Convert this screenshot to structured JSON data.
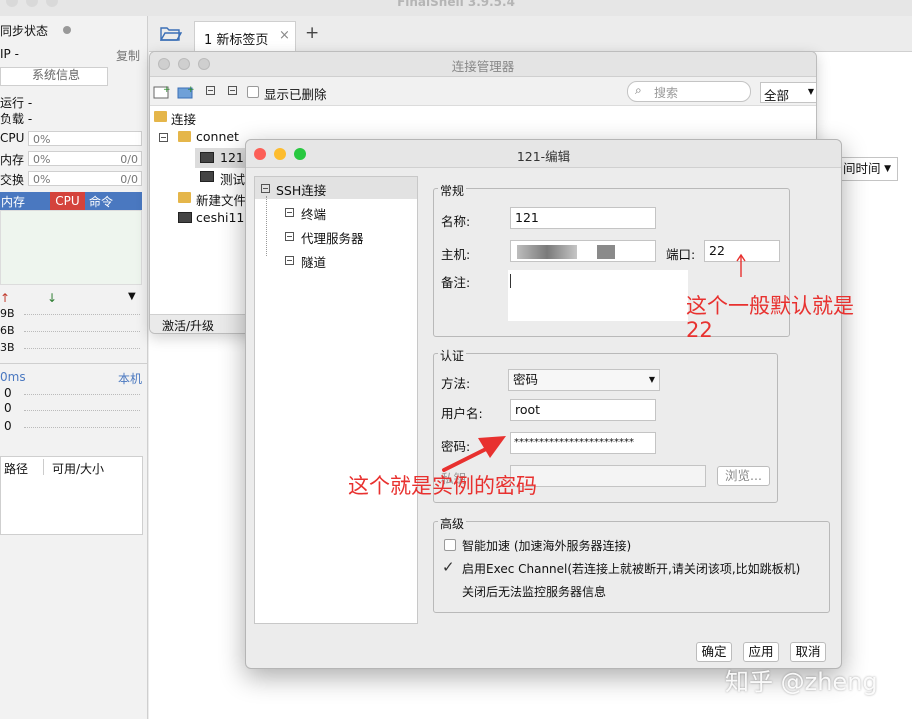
{
  "app": {
    "title": "FinalShell 3.9.5.4"
  },
  "left_panel": {
    "sync_status": "同步状态",
    "ip_label": "IP -",
    "copy_label": "复制",
    "sysinfo_button": "系统信息",
    "running": "运行 -",
    "load": "负载 -",
    "cpu_label": "CPU",
    "cpu_value": "0%",
    "mem_label": "内存",
    "mem_value": "0%",
    "mem_ratio": "0/0",
    "swap_label": "交换",
    "swap_value": "0%",
    "swap_ratio": "0/0",
    "table_headers": [
      "内存",
      "CPU",
      "命令"
    ],
    "net_rows": [
      "9B",
      "6B",
      "3B"
    ],
    "latency": "0ms",
    "local": "本机",
    "zeros": [
      "0",
      "0",
      "0"
    ],
    "disk_headers": [
      "路径",
      "可用/大小"
    ]
  },
  "tabs": [
    {
      "label": "1 新标签页"
    }
  ],
  "conn_manager": {
    "title": "连接管理器",
    "show_deleted": "显示已删除",
    "search_placeholder": "搜索",
    "filter_value": "全部",
    "tree": {
      "root": "连接",
      "folder": "connet",
      "items": [
        "121",
        "测试"
      ],
      "new_folder": "新建文件",
      "ceshi": "ceshi11"
    },
    "activate_button": "激活/升级",
    "sort_dropdown": "间时间"
  },
  "editor": {
    "title": "121-编辑",
    "side_tree": {
      "root": "SSH连接",
      "children": [
        "终端",
        "代理服务器",
        "隧道"
      ]
    },
    "general": {
      "title": "常规",
      "name_label": "名称:",
      "name_value": "121",
      "host_label": "主机:",
      "port_label": "端口:",
      "port_value": "22",
      "note_label": "备注:"
    },
    "auth": {
      "title": "认证",
      "method_label": "方法:",
      "method_value": "密码",
      "user_label": "用户名:",
      "user_value": "root",
      "password_label": "密码:",
      "password_value": "************************",
      "key_label": "私钥",
      "browse_button": "浏览..."
    },
    "advanced": {
      "title": "高级",
      "smart_accel": "智能加速 (加速海外服务器连接)",
      "exec_channel": "启用Exec Channel(若连接上就被断开,请关闭该项,比如跳板机)",
      "exec_note": "关闭后无法监控服务器信息"
    },
    "buttons": {
      "ok": "确定",
      "apply": "应用",
      "cancel": "取消"
    }
  },
  "annotations": {
    "port_note": "这个一般默认就是",
    "port_note_value": "22",
    "password_note": "这个就是实例的密码"
  },
  "watermark": "知乎 @zheng",
  "colors": {
    "accent_blue": "#4a78c0",
    "cpu_red": "#d4433c",
    "annotation_red": "#e8312f"
  }
}
